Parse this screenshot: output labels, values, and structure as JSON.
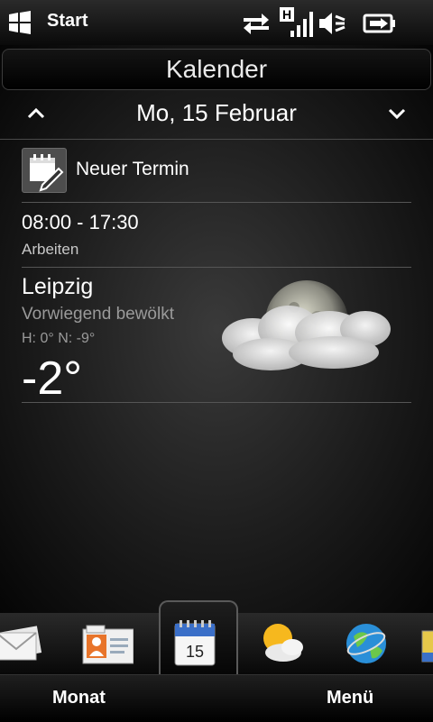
{
  "status": {
    "start_label": "Start",
    "network_letter": "H",
    "icons": [
      "windows-logo",
      "data-transfer-icon",
      "signal-strength-icon",
      "speaker-muted-icon",
      "battery-charging-icon"
    ]
  },
  "header": {
    "title": "Kalender",
    "date": "Mo, 15 Februar"
  },
  "appointment": {
    "new_label": "Neuer Termin",
    "time_range": "08:00 - 17:30",
    "subject": "Arbeiten"
  },
  "weather": {
    "city": "Leipzig",
    "condition": "Vorwiegend bewölkt",
    "high_low": "H: 0° N: -9°",
    "temperature": "-2°"
  },
  "dock": {
    "items": [
      "mail-icon",
      "contacts-icon",
      "calendar-icon",
      "weather-icon",
      "internet-globe-icon",
      "partial-app-icon"
    ],
    "calendar_day": "15",
    "selected": "calendar-icon"
  },
  "softkeys": {
    "left": "Monat",
    "right": "Menü"
  },
  "colors": {
    "background": "#000000",
    "text": "#ffffff",
    "muted_text": "#9a9a9a"
  }
}
